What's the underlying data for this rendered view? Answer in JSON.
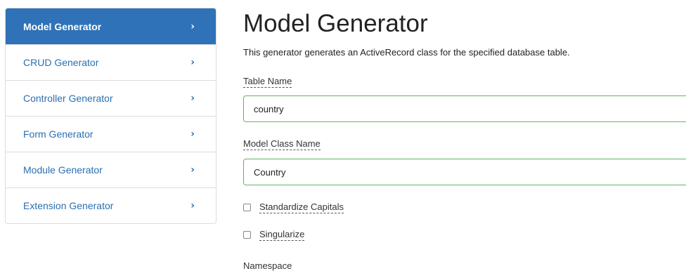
{
  "sidebar": {
    "items": [
      {
        "label": "Model Generator",
        "active": true
      },
      {
        "label": "CRUD Generator",
        "active": false
      },
      {
        "label": "Controller Generator",
        "active": false
      },
      {
        "label": "Form Generator",
        "active": false
      },
      {
        "label": "Module Generator",
        "active": false
      },
      {
        "label": "Extension Generator",
        "active": false
      }
    ],
    "chevron_icon": "chevron-right-icon",
    "active_color": "#2f72b7",
    "link_color": "#2a6fb0"
  },
  "main": {
    "title": "Model Generator",
    "description": "This generator generates an ActiveRecord class for the specified database table.",
    "fields": {
      "table_name": {
        "label": "Table Name",
        "value": "country"
      },
      "model_class_name": {
        "label": "Model Class Name",
        "value": "Country"
      }
    },
    "checkboxes": {
      "standardize_capitals": {
        "label": "Standardize Capitals",
        "checked": false
      },
      "singularize": {
        "label": "Singularize",
        "checked": false
      }
    },
    "namespace_label": "Namespace",
    "valid_border_color": "#5cb85c"
  }
}
